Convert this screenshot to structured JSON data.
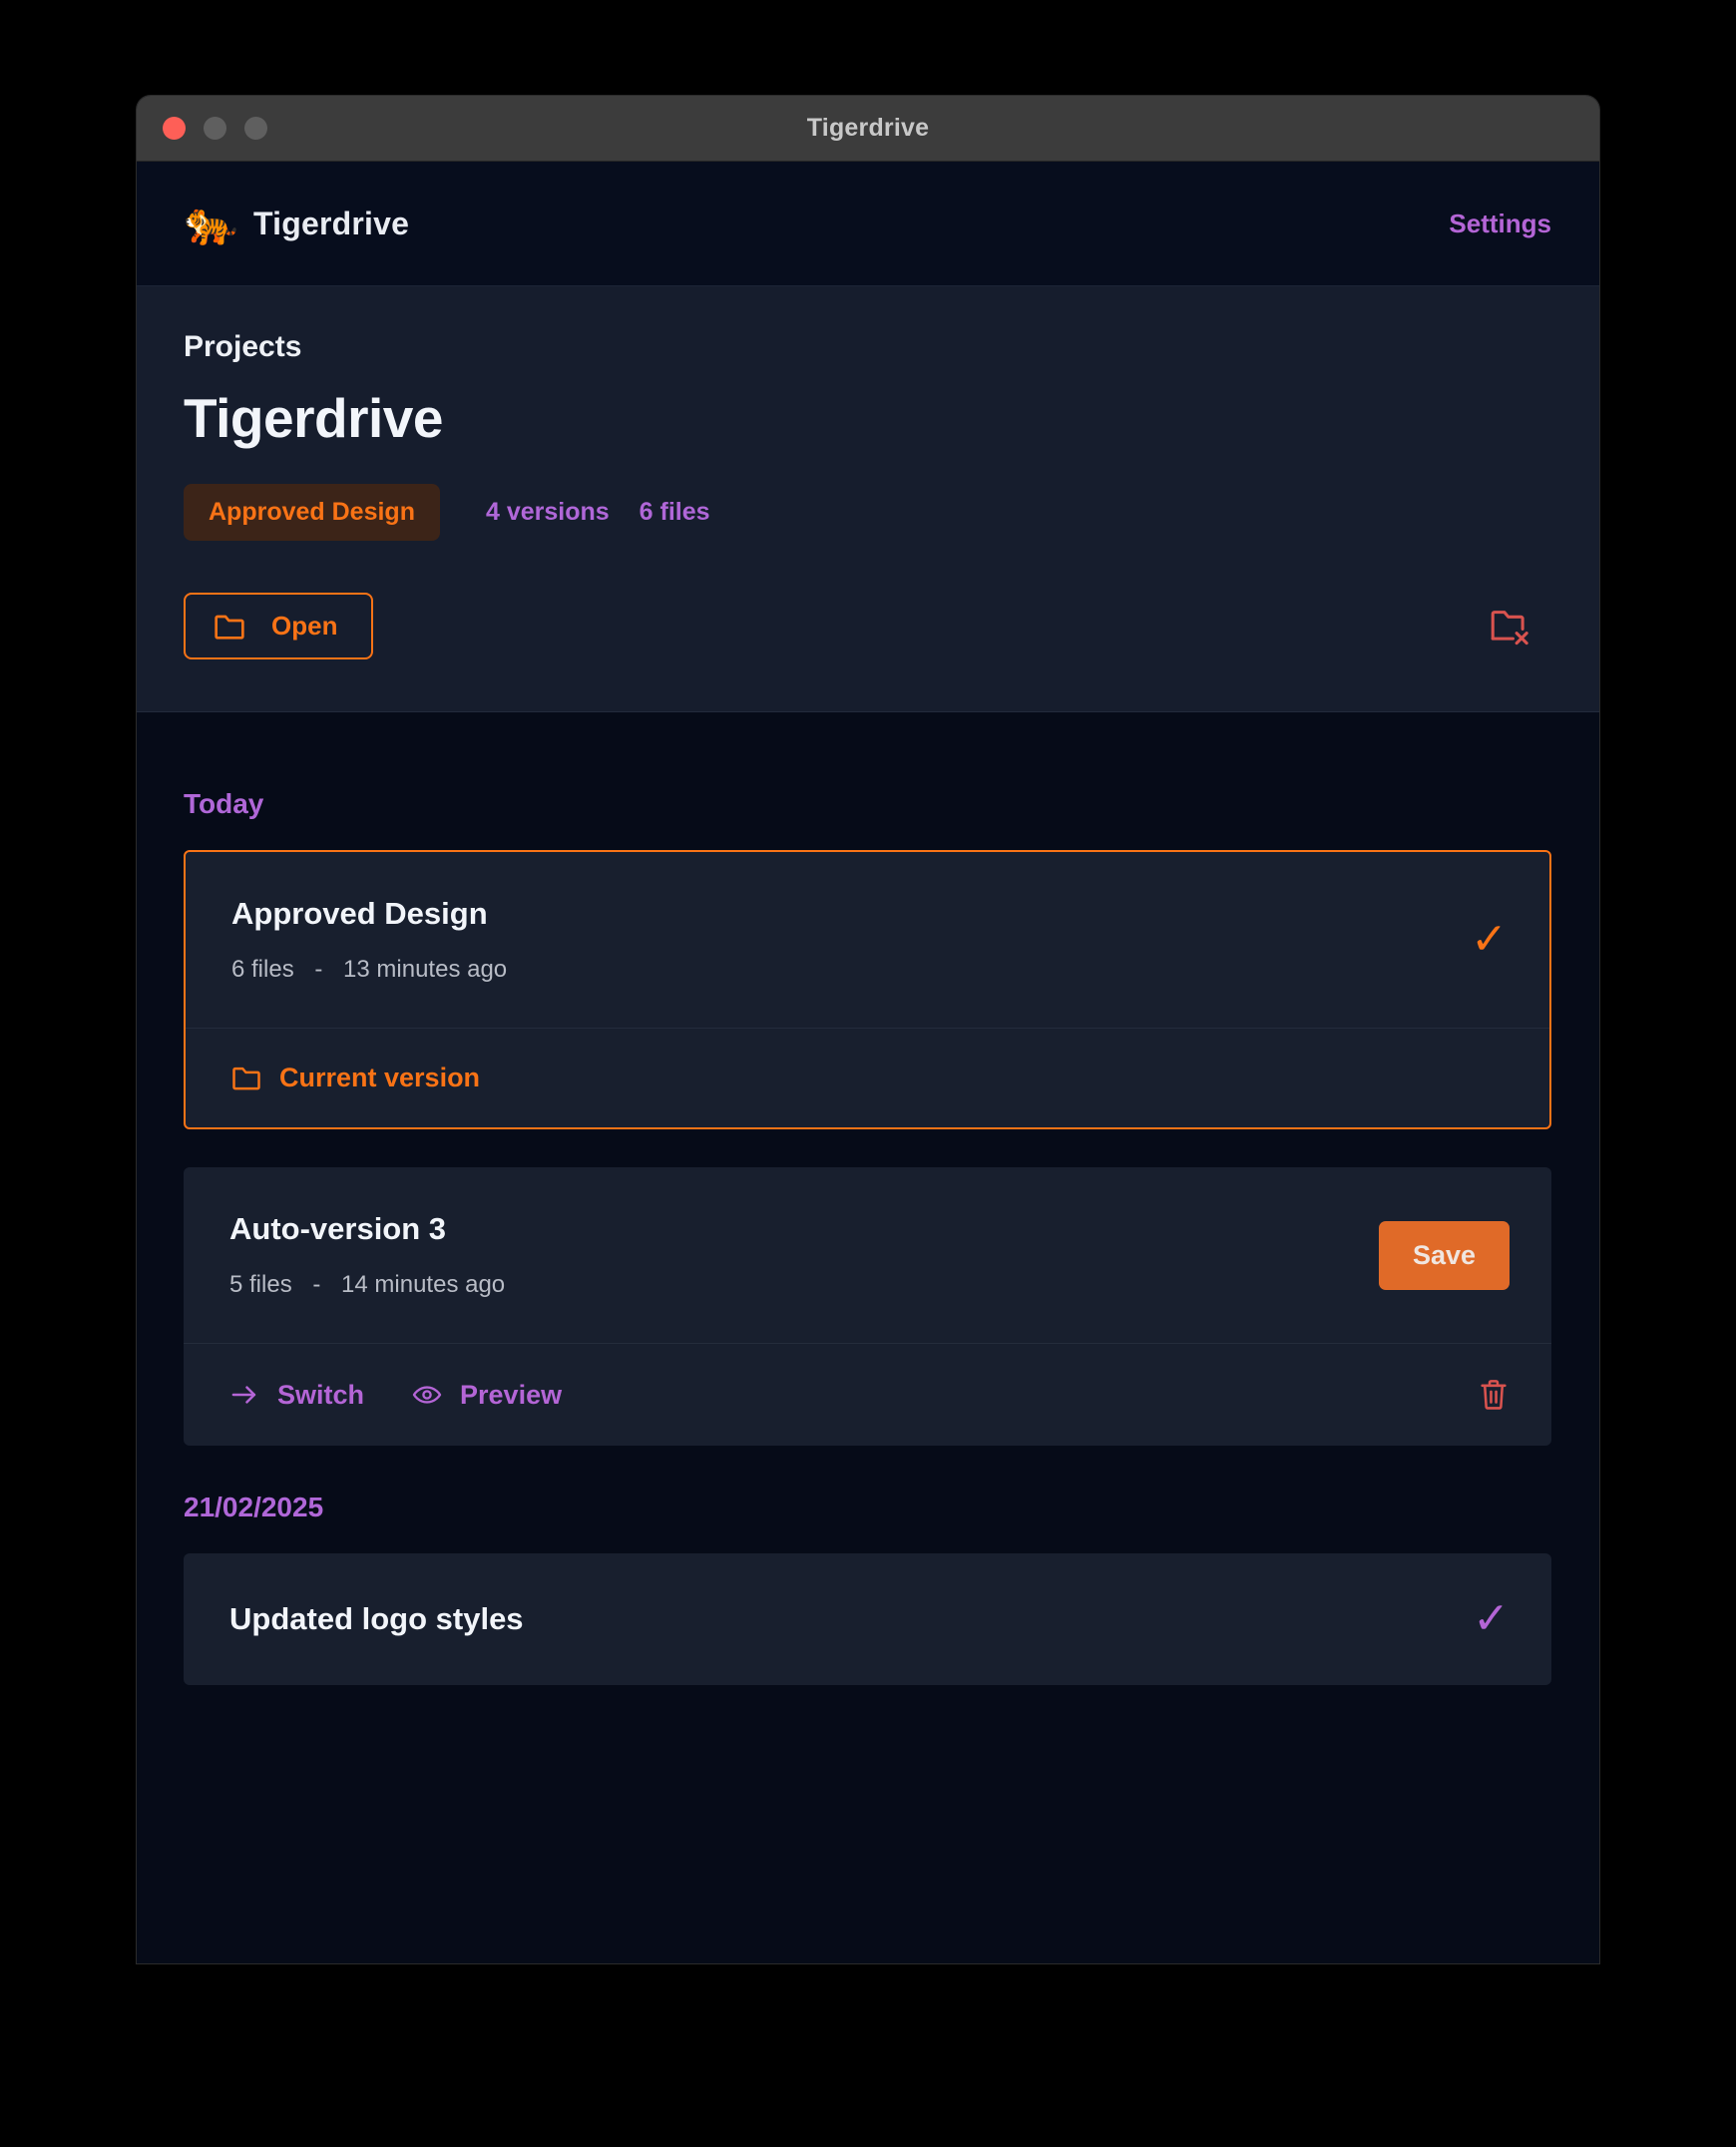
{
  "window": {
    "title": "Tigerdrive",
    "traffic_lights": [
      "close-button",
      "minimize-button",
      "maximize-button"
    ]
  },
  "app_header": {
    "logo_icon": "tiger-head-icon",
    "logo_glyph": "🐅",
    "brand": "Tigerdrive",
    "settings_label": "Settings"
  },
  "hero": {
    "breadcrumb": "Projects",
    "project_title": "Tigerdrive",
    "status_badge": "Approved Design",
    "versions_count": "4 versions",
    "files_count": "6 files",
    "open_label": "Open",
    "open_icon": "folder-icon",
    "remove_icon": "folder-remove-icon"
  },
  "groups": [
    {
      "label": "Today",
      "cards": [
        {
          "title": "Approved Design",
          "files": "6 files",
          "separator": "-",
          "time": "13 minutes ago",
          "status_icon": "check-icon",
          "status_glyph": "✓",
          "status_color": "#f97316",
          "active": true,
          "footer": {
            "primary_label": "Current version",
            "primary_icon": "folder-icon"
          }
        },
        {
          "title": "Auto-version 3",
          "files": "5 files",
          "separator": "-",
          "time": "14 minutes ago",
          "save_label": "Save",
          "active": false,
          "footer": {
            "switch_label": "Switch",
            "switch_icon": "arrow-right-icon",
            "preview_label": "Preview",
            "preview_icon": "eye-icon",
            "delete_icon": "trash-icon"
          }
        }
      ]
    },
    {
      "label": "21/02/2025",
      "cards": [
        {
          "title": "Updated logo styles",
          "status_icon": "check-icon",
          "status_glyph": "✓",
          "status_color": "#b465d6",
          "active": false
        }
      ]
    }
  ],
  "colors": {
    "accent_orange": "#f97316",
    "accent_purple": "#b465d6",
    "danger_red": "#d9534f",
    "window_bg": "#060b18",
    "hero_bg": "#161d2d",
    "card_bg": "#181f2e",
    "titlebar_bg": "#3c3c3c"
  }
}
